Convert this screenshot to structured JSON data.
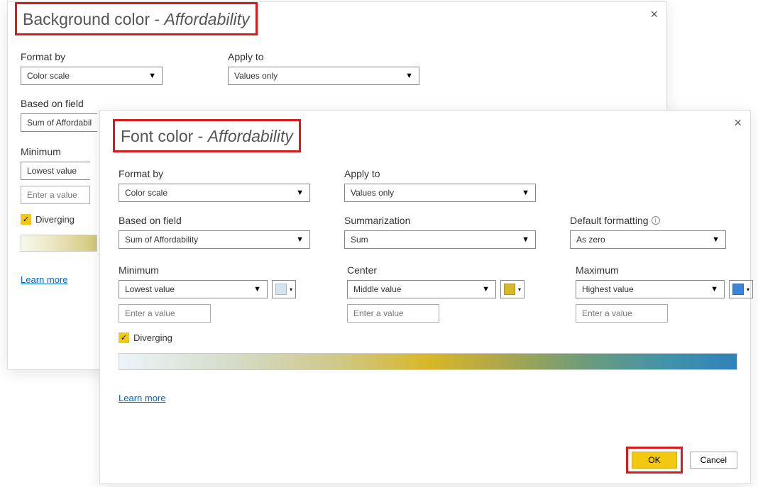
{
  "back": {
    "title_prefix": "Background color - ",
    "title_em": "Affordability",
    "format_by_label": "Format by",
    "format_by_value": "Color scale",
    "apply_to_label": "Apply to",
    "apply_to_value": "Values only",
    "based_on_field_label": "Based on field",
    "based_on_field_value": "Sum of Affordabil",
    "minimum_label": "Minimum",
    "minimum_value": "Lowest value",
    "enter_value_placeholder": "Enter a value",
    "diverging_label": "Diverging",
    "learn_more": "Learn more"
  },
  "front": {
    "title_prefix": "Font color - ",
    "title_em": "Affordability",
    "format_by_label": "Format by",
    "format_by_value": "Color scale",
    "apply_to_label": "Apply to",
    "apply_to_value": "Values only",
    "based_on_field_label": "Based on field",
    "based_on_field_value": "Sum of Affordability",
    "summarization_label": "Summarization",
    "summarization_value": "Sum",
    "default_formatting_label": "Default formatting",
    "default_formatting_value": "As zero",
    "minimum_label": "Minimum",
    "minimum_value": "Lowest value",
    "minimum_color": "#d6e4f0",
    "center_label": "Center",
    "center_value": "Middle value",
    "center_color": "#d8b728",
    "maximum_label": "Maximum",
    "maximum_value": "Highest value",
    "maximum_color": "#3a86d6",
    "enter_value_placeholder": "Enter a value",
    "diverging_label": "Diverging",
    "learn_more": "Learn more",
    "ok_label": "OK",
    "cancel_label": "Cancel"
  }
}
